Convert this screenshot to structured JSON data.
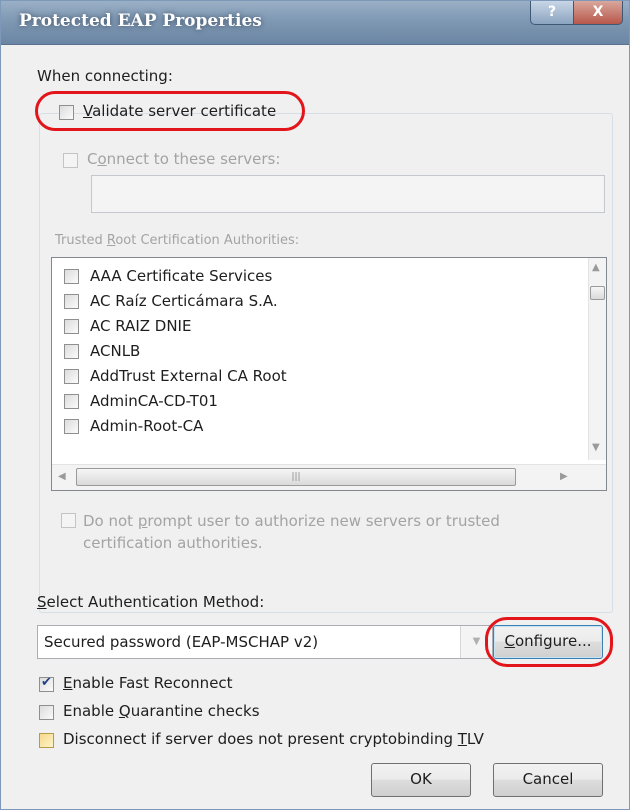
{
  "window": {
    "title": "Protected EAP Properties",
    "help_glyph": "?",
    "close_glyph": "X"
  },
  "connecting": {
    "label": "When connecting:",
    "validate_cert": {
      "accel": "V",
      "rest": "alidate server certificate",
      "checked": false
    },
    "connect_servers": {
      "before": "C",
      "accel": "o",
      "rest": "nnect to these servers:",
      "checked": false,
      "value": ""
    },
    "trusted_label": {
      "before": "Trusted ",
      "accel": "R",
      "rest": "oot Certification Authorities:"
    },
    "ca_list": [
      "AAA Certificate Services",
      "AC Raíz Certicámara S.A.",
      "AC RAIZ DNIE",
      "ACNLB",
      "AddTrust External CA Root",
      "AdminCA-CD-T01",
      "Admin-Root-CA"
    ],
    "do_not_prompt": {
      "line1_before": "Do not ",
      "line1_accel": "p",
      "line1_rest": "rompt user to authorize new servers or trusted",
      "line2": "certification authorities."
    }
  },
  "auth": {
    "label_accel": "S",
    "label_rest": "elect Authentication Method:",
    "method_value": "Secured password (EAP-MSCHAP v2)",
    "configure_accel": "C",
    "configure_rest": "onfigure..."
  },
  "options": {
    "fast_reconnect": {
      "accel": "E",
      "rest": "nable Fast Reconnect",
      "checked": true
    },
    "quarantine": {
      "before": "Enable ",
      "accel": "Q",
      "rest": "uarantine checks",
      "checked": false
    },
    "cryptobinding": {
      "before": "Disconnect if server does not present cryptobinding ",
      "accel": "T",
      "rest": "LV",
      "checked": false
    }
  },
  "buttons": {
    "ok": "OK",
    "cancel": "Cancel"
  },
  "scroll": {
    "up": "▲",
    "down": "▼",
    "left": "◀",
    "right": "▶",
    "grip": "|||"
  },
  "colors": {
    "highlight": "#e2151b",
    "titlebar": "#7f98b3",
    "dialog_bg": "#f0f0f0"
  }
}
